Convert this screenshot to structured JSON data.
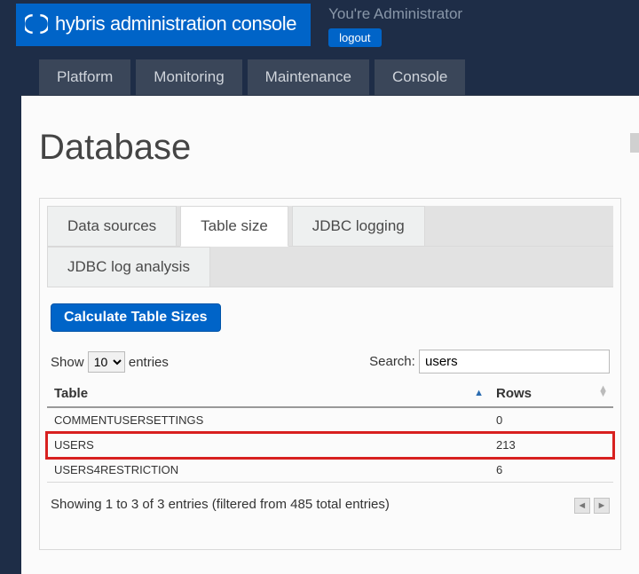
{
  "header": {
    "brand": "hybris administration console",
    "user_line": "You're Administrator",
    "logout_label": "logout"
  },
  "nav": {
    "items": [
      "Platform",
      "Monitoring",
      "Maintenance",
      "Console"
    ]
  },
  "page": {
    "title": "Database"
  },
  "tabs": {
    "items": [
      {
        "label": "Data sources",
        "active": false
      },
      {
        "label": "Table size",
        "active": true
      },
      {
        "label": "JDBC logging",
        "active": false
      },
      {
        "label": "JDBC log analysis",
        "active": false
      }
    ]
  },
  "actions": {
    "calc_label": "Calculate Table Sizes"
  },
  "datatable": {
    "length_prefix": "Show",
    "length_suffix": "entries",
    "length_value": "10",
    "search_label": "Search:",
    "search_value": "users",
    "columns": [
      "Table",
      "Rows"
    ],
    "rows": [
      {
        "table": "COMMENTUSERSETTINGS",
        "rows": "0",
        "highlight": false
      },
      {
        "table": "USERS",
        "rows": "213",
        "highlight": true
      },
      {
        "table": "USERS4RESTRICTION",
        "rows": "6",
        "highlight": false
      }
    ],
    "info": "Showing 1 to 3 of 3 entries (filtered from 485 total entries)"
  }
}
